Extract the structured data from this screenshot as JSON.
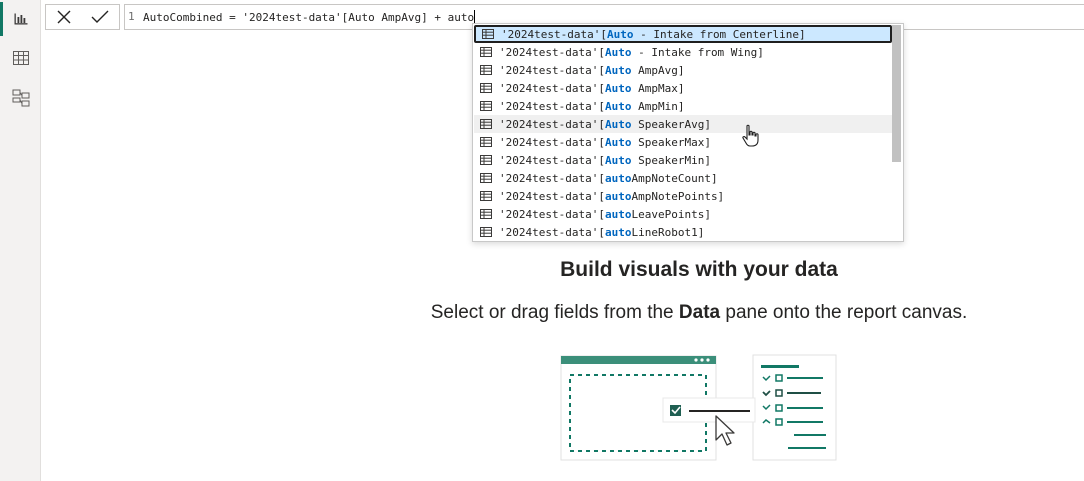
{
  "formula_bar": {
    "line_number": "1",
    "expression": "AutoCombined = '2024test-data'[Auto AmpAvg] + auto"
  },
  "autocomplete": {
    "items": [
      {
        "prefix": "'2024test-data'[",
        "match": "Auto",
        "rest": " - Intake from Centerline]"
      },
      {
        "prefix": "'2024test-data'[",
        "match": "Auto",
        "rest": " - Intake from Wing]"
      },
      {
        "prefix": "'2024test-data'[",
        "match": "Auto",
        "rest": " AmpAvg]"
      },
      {
        "prefix": "'2024test-data'[",
        "match": "Auto",
        "rest": " AmpMax]"
      },
      {
        "prefix": "'2024test-data'[",
        "match": "Auto",
        "rest": " AmpMin]"
      },
      {
        "prefix": "'2024test-data'[",
        "match": "Auto",
        "rest": " SpeakerAvg]"
      },
      {
        "prefix": "'2024test-data'[",
        "match": "Auto",
        "rest": " SpeakerMax]"
      },
      {
        "prefix": "'2024test-data'[",
        "match": "Auto",
        "rest": " SpeakerMin]"
      },
      {
        "prefix": "'2024test-data'[",
        "match": "auto",
        "rest": "AmpNoteCount]"
      },
      {
        "prefix": "'2024test-data'[",
        "match": "auto",
        "rest": "AmpNotePoints]"
      },
      {
        "prefix": "'2024test-data'[",
        "match": "auto",
        "rest": "LeavePoints]"
      },
      {
        "prefix": "'2024test-data'[",
        "match": "auto",
        "rest": "LineRobot1]"
      }
    ]
  },
  "empty_state": {
    "heading": "Build visuals with your data",
    "sub_before": "Select or drag fields from the ",
    "sub_bold": "Data",
    "sub_after": " pane onto the report canvas."
  },
  "colors": {
    "accent": "#117865",
    "highlight_text": "#0066bf",
    "selected_bg": "#cce8ff"
  },
  "icons": {
    "rail": [
      "report-view-icon",
      "table-view-icon",
      "model-view-icon"
    ],
    "formula_bar": [
      "cancel-icon",
      "commit-check-icon"
    ],
    "suggestion": "table-column-icon"
  }
}
